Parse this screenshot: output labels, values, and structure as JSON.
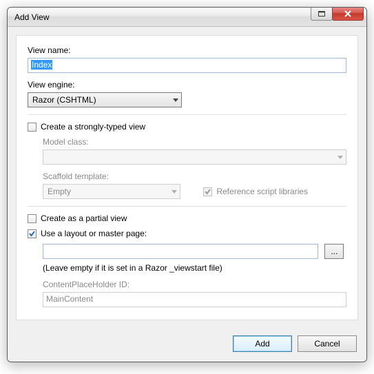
{
  "titlebar": {
    "title": "Add View"
  },
  "view_name": {
    "label": "View name:",
    "value": "Index"
  },
  "view_engine": {
    "label": "View engine:",
    "value": "Razor (CSHTML)"
  },
  "strongly_typed": {
    "label": "Create a strongly-typed view",
    "checked": false,
    "model_class": {
      "label": "Model class:",
      "value": ""
    },
    "scaffold": {
      "label": "Scaffold template:",
      "value": "Empty"
    },
    "ref_libs": {
      "label": "Reference script libraries",
      "checked": true
    }
  },
  "partial": {
    "label": "Create as a partial view",
    "checked": false
  },
  "layout": {
    "label": "Use a layout or master page:",
    "checked": true,
    "value": "",
    "browse_label": "...",
    "hint": "(Leave empty if it is set in a Razor _viewstart file)",
    "cph": {
      "label": "ContentPlaceHolder ID:",
      "value": "MainContent"
    }
  },
  "buttons": {
    "add": "Add",
    "cancel": "Cancel"
  }
}
